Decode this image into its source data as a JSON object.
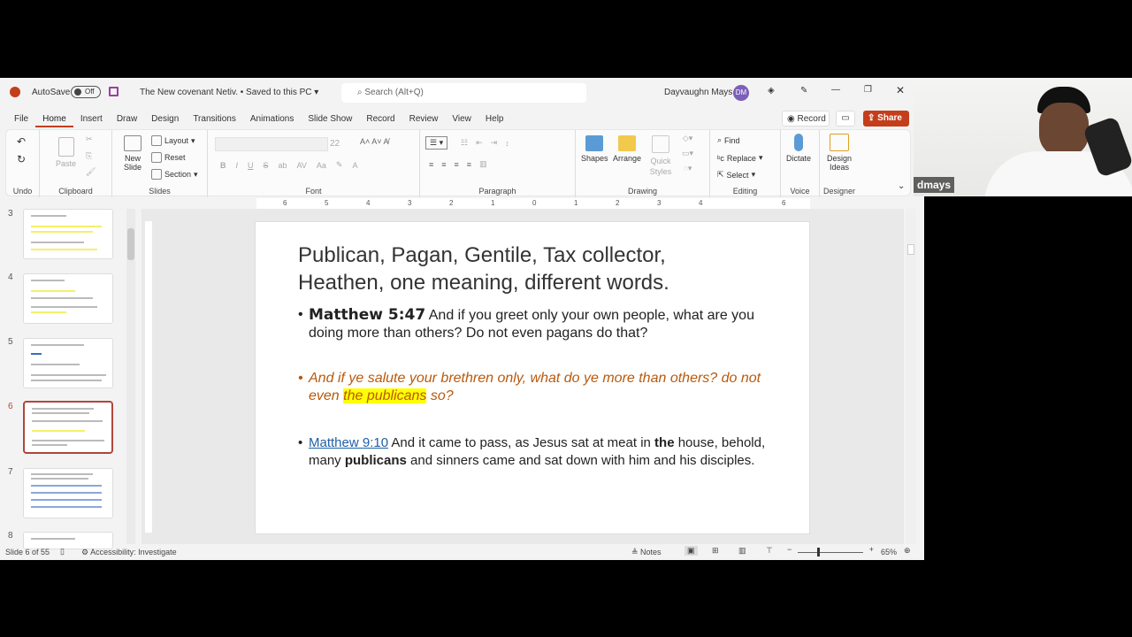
{
  "titlebar": {
    "autosave": "AutoSave",
    "autosave_state": "Off",
    "doc_title": "The New covenant Netiv. • Saved to this PC",
    "search_placeholder": "Search (Alt+Q)",
    "user": "Dayvaughn Mays",
    "initials": "DM"
  },
  "tabs": [
    "File",
    "Home",
    "Insert",
    "Draw",
    "Design",
    "Transitions",
    "Animations",
    "Slide Show",
    "Record",
    "Review",
    "View",
    "Help"
  ],
  "actions": {
    "record": "Record",
    "share": "Share"
  },
  "ribbon": {
    "groups": {
      "undo": "Undo",
      "clipboard": "Clipboard",
      "slides": "Slides",
      "font": "Font",
      "paragraph": "Paragraph",
      "drawing": "Drawing",
      "editing": "Editing",
      "voice": "Voice",
      "designer": "Designer"
    },
    "paste": "Paste",
    "new_slide": "New Slide",
    "layout": "Layout",
    "reset": "Reset",
    "section": "Section",
    "font_size": "22",
    "shapes": "Shapes",
    "arrange": "Arrange",
    "quick_styles": "Quick Styles",
    "find": "Find",
    "replace": "Replace",
    "select": "Select",
    "dictate": "Dictate",
    "design_ideas": "Design Ideas"
  },
  "ruler": [
    "6",
    "5",
    "4",
    "3",
    "2",
    "1",
    "0",
    "1",
    "2",
    "3",
    "4",
    "6"
  ],
  "slides_panel": {
    "numbers": [
      "3",
      "4",
      "5",
      "6",
      "7",
      "8"
    ],
    "selected": "6"
  },
  "slide": {
    "title": "Publican, Pagan, Gentile, Tax collector, Heathen, one meaning, different words.",
    "b1_ref": "Matthew 5:47",
    "b1_text": " And if you greet only your own people, what are you doing more than others? Do not even pagans do that?",
    "b2_pre": "And if ye salute your brethren only, what do ye more than others? do not even ",
    "b2_highlight": "the publicans",
    "b2_post": " so?",
    "b3_ref": "Matthew 9:10",
    "b3_a": " And it came to pass, as Jesus sat at meat in ",
    "b3_the": "the",
    "b3_b": " house, behold, many ",
    "b3_pub": "publicans",
    "b3_c": " and sinners came and sat down with him and his disciples."
  },
  "status": {
    "slide": "Slide 6 of 55",
    "accessibility": "Accessibility: Investigate",
    "notes": "Notes",
    "zoom": "65%"
  },
  "webcam": {
    "name": "dmays"
  },
  "colors": {
    "accent": "#c43e1c",
    "highlight": "#ffff00",
    "italic": "#b9590c",
    "link": "#1f5fa8"
  }
}
